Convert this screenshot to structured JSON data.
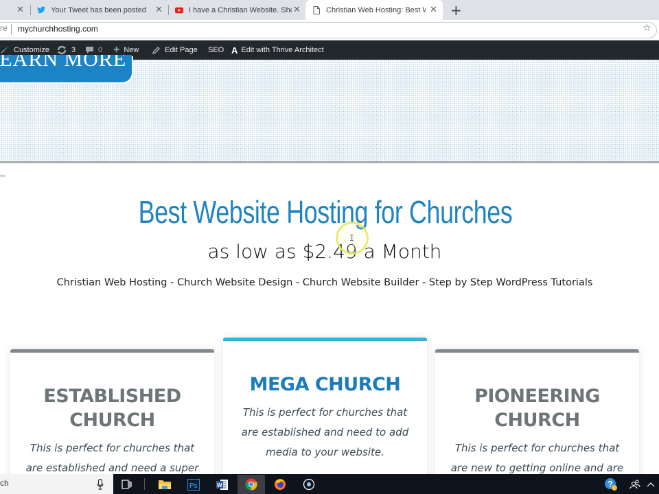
{
  "browser": {
    "tabs": [
      {
        "title": "",
        "icon": "unknown-favicon",
        "active": false
      },
      {
        "title": "Your Tweet has been posted!",
        "icon": "twitter-bird-icon",
        "active": false
      },
      {
        "title": "I have a Christian Website. Should",
        "icon": "youtube-icon",
        "active": false
      },
      {
        "title": "Christian Web Hosting: Best Web",
        "icon": "page-icon",
        "active": true
      }
    ],
    "close_glyph": "✕",
    "new_tab_glyph": "+",
    "address_prefix": "re",
    "address_url": "mychurchhosting.com",
    "bookmark_glyph": "☆"
  },
  "adminbar": {
    "customize": "Customize",
    "updates_count": "3",
    "comments_count": "0",
    "new": "New",
    "edit_page": "Edit Page",
    "seo": "SEO",
    "thrive": "Edit with Thrive Architect"
  },
  "hero": {
    "button_label": "LEARN MORE"
  },
  "main": {
    "title": "Best Website Hosting for Churches",
    "subtitle": "as low as $2.49 a Month",
    "links": "Christian Web Hosting - Church Website Design - Church Website Builder - Step by Step WordPress Tutorials"
  },
  "plans": [
    {
      "title_line1": "ESTABLISHED",
      "title_line2": "CHURCH",
      "desc": "This is perfect for churches that are established and need a super",
      "accent": "#7f8a90"
    },
    {
      "title_line1": "MEGA CHURCH",
      "title_line2": "",
      "desc": "This is perfect for churches that are established and need to add media to your website.",
      "accent": "#35b3dd"
    },
    {
      "title_line1": "PIONEERING",
      "title_line2": "CHURCH",
      "desc": "This is perfect for churches that are new to getting online and are",
      "accent": "#7f8a90"
    }
  ],
  "colors": {
    "brand_blue": "#1f84c2",
    "plan_title_gray": "#6d7579",
    "mega_title_blue": "#1a7bbd",
    "adminbar_bg": "#23282d"
  },
  "taskbar": {
    "search_text": "ch",
    "apps": [
      "task-view",
      "file-explorer",
      "photoshop",
      "word",
      "chrome",
      "firefox",
      "cortana"
    ]
  }
}
